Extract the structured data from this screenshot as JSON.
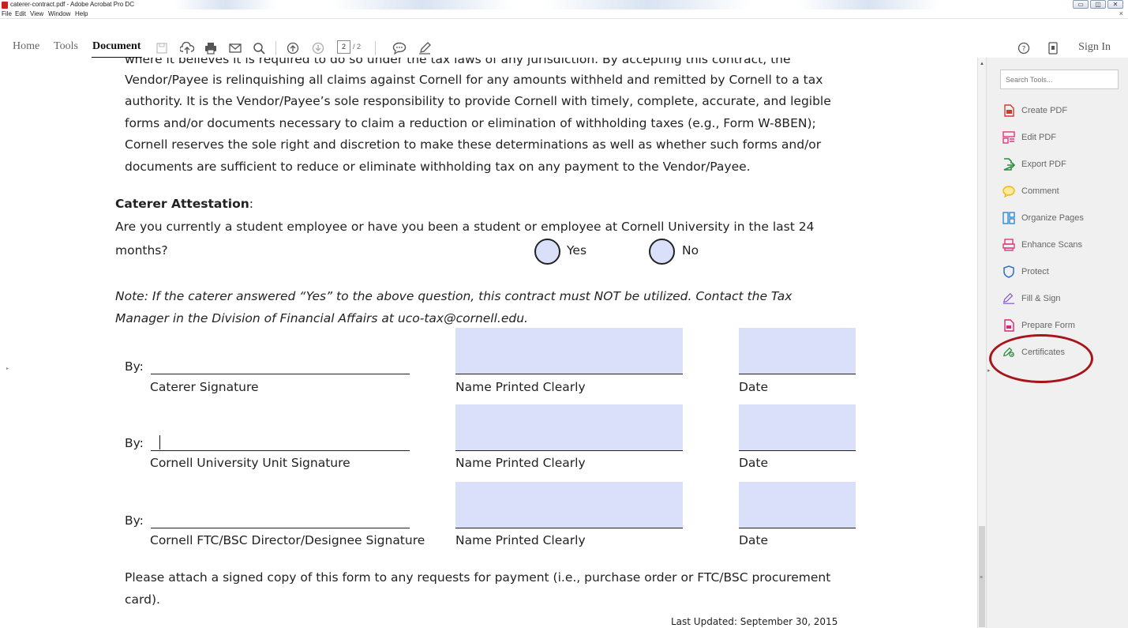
{
  "window": {
    "title": "caterer-contract.pdf - Adobe Acrobat Pro DC",
    "min_label": "▭",
    "max_label": "◫",
    "close_label": "✕",
    "doc_close_label": "×"
  },
  "menu": [
    "File",
    "Edit",
    "View",
    "Window",
    "Help"
  ],
  "toolbar": {
    "tabs": [
      "Home",
      "Tools",
      "Document"
    ],
    "active_tab": "Document",
    "page_current": "2",
    "page_total": "/ 2",
    "sign_in": "Sign In",
    "icons": [
      "save-icon",
      "upload-icon",
      "print-icon",
      "email-icon",
      "search-icon",
      "page-up-icon",
      "page-down-icon",
      "comment-icon",
      "pen-icon",
      "help-icon",
      "mobile-icon"
    ]
  },
  "document": {
    "cutoff_line": "where it believes it is required to do so under the tax laws of any jurisdiction. By accepting this contract, the",
    "paragraph": [
      "Vendor/Payee is relinquishing all claims against Cornell for any amounts withheld and remitted by Cornell to a tax",
      "authority. It is the Vendor/Payee’s sole responsibility to provide Cornell with timely, complete, accurate, and legible",
      "forms and/or documents necessary to claim a reduction or elimination of withholding taxes (e.g., Form W-8BEN);",
      "Cornell reserves the sole right and discretion to make these determinations as well as whether such forms and/or",
      "documents are sufficient to reduce or eliminate withholding tax on any payment to the Vendor/Payee."
    ],
    "attestation_heading": "Caterer Attestation",
    "attestation_colon": ":",
    "question_line1": "Are you currently a student employee or have you been a student or employee at Cornell University in the last 24",
    "question_line2": "months?",
    "yes_label": "Yes",
    "no_label": "No",
    "note_line1": "Note:  If the caterer answered “Yes” to the above question, this contract must NOT be utilized. Contact the Tax",
    "note_line2": "Manager in the Division of Financial Affairs at uco-tax@cornell.edu.",
    "by_label": "By:",
    "signatures": [
      {
        "sig_label": "Caterer Signature",
        "name_label": "Name Printed Clearly",
        "date_label": "Date"
      },
      {
        "sig_label": "Cornell University Unit Signature",
        "name_label": "Name Printed Clearly",
        "date_label": "Date"
      },
      {
        "sig_label": "Cornell FTC/BSC Director/Designee Signature",
        "name_label": "Name Printed Clearly",
        "date_label": "Date"
      }
    ],
    "footer_line1": "Please attach a signed copy of this form to any requests for payment (i.e., purchase order or FTC/BSC procurement",
    "footer_line2": "card).",
    "last_updated": "Last Updated:  September 30, 2015"
  },
  "tools_pane": {
    "search_placeholder": "Search Tools...",
    "items": [
      {
        "label": "Create PDF",
        "icon": "create-pdf-icon",
        "color": "#d9362b"
      },
      {
        "label": "Edit PDF",
        "icon": "edit-pdf-icon",
        "color": "#e0387a"
      },
      {
        "label": "Export PDF",
        "icon": "export-pdf-icon",
        "color": "#2e8b3e"
      },
      {
        "label": "Comment",
        "icon": "comment-icon",
        "color": "#f2b800"
      },
      {
        "label": "Organize Pages",
        "icon": "organize-pages-icon",
        "color": "#2f8bd1"
      },
      {
        "label": "Enhance Scans",
        "icon": "enhance-scans-icon",
        "color": "#e0387a"
      },
      {
        "label": "Protect",
        "icon": "protect-icon",
        "color": "#2f6fc9"
      },
      {
        "label": "Fill & Sign",
        "icon": "fill-sign-icon",
        "color": "#8a5cd1"
      },
      {
        "label": "Prepare Form",
        "icon": "prepare-form-icon",
        "color": "#d6277a"
      },
      {
        "label": "Certificates",
        "icon": "certificates-icon",
        "color": "#2e8b3e"
      }
    ],
    "highlight_color": "#a8141c"
  }
}
